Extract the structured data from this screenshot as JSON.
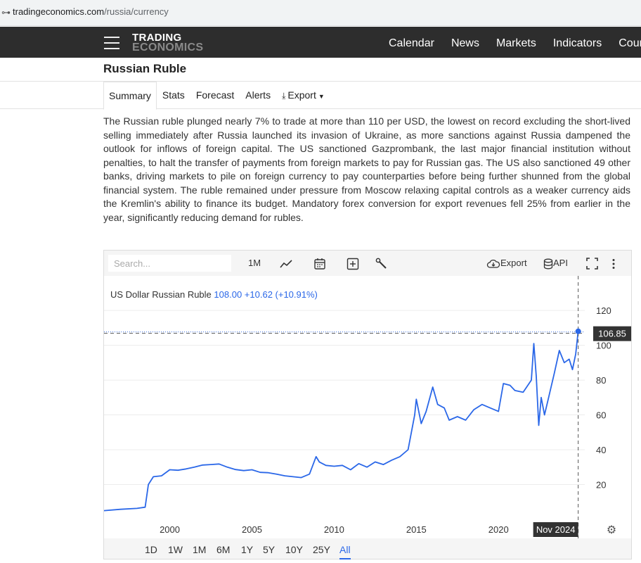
{
  "browser": {
    "url_host": "tradingeconomics.com",
    "url_path": "/russia/currency"
  },
  "nav": {
    "logo_line1": "TRADING",
    "logo_line2": "ECONOMICS",
    "links": [
      "Calendar",
      "News",
      "Markets",
      "Indicators",
      "Countries"
    ]
  },
  "page": {
    "title": "Russian Ruble"
  },
  "tabs": {
    "summary": "Summary",
    "stats": "Stats",
    "forecast": "Forecast",
    "alerts": "Alerts",
    "export": "Export"
  },
  "summary_text": "The Russian ruble plunged nearly 7% to trade at more than 110 per USD, the lowest on record excluding the short-lived selling immediately after Russia launched its invasion of Ukraine, as more sanctions against Russia dampened the outlook for inflows of foreign capital. The US sanctioned Gazprombank, the last major financial institution without penalties, to halt the transfer of payments from foreign markets to pay for Russian gas. The US also sanctioned 49 other banks, driving markets to pile on foreign currency to pay counterparties before being further shunned from the global financial system. The ruble remained under pressure from Moscow relaxing capital controls as a weaker currency aids the Kremlin's ability to finance its budget. Mandatory forex conversion for export revenues fell 25% from earlier in the year, significantly reducing demand for rubles.",
  "chart_toolbar": {
    "search_placeholder": "Search...",
    "interval_label": "1M",
    "line_icon": "line-chart-icon",
    "calendar_icon": "calendar-icon",
    "compare_icon": "plus-square-icon",
    "tools_icon": "wrench-icon",
    "export_label": "Export",
    "api_label": "API",
    "fullscreen_icon": "fullscreen-icon",
    "more_icon": "more-vertical-icon"
  },
  "chart_header": {
    "name": "US Dollar Russian Ruble",
    "value": "108.00",
    "change": "+10.62 (+10.91%)"
  },
  "crosshair": {
    "date_label": "Nov 2024",
    "price_label": "106.85",
    "price": 106.85
  },
  "range_buttons": [
    "1D",
    "1W",
    "1M",
    "6M",
    "1Y",
    "5Y",
    "10Y",
    "25Y",
    "All"
  ],
  "range_active": "All",
  "settings_icon": "gear-icon",
  "colors": {
    "series": "#2a67e8",
    "nav_bg": "#2d2d2d",
    "label_bg": "#333333"
  },
  "chart_data": {
    "type": "line",
    "title": "US Dollar Russian Ruble",
    "x_tick_labels": [
      "2000",
      "2005",
      "2010",
      "2015",
      "2020"
    ],
    "y_tick_labels": [
      "20",
      "40",
      "60",
      "80",
      "100",
      "120"
    ],
    "xlim": [
      1996.0,
      2025.25
    ],
    "ylim": [
      0,
      135
    ],
    "grid": "horizontal",
    "series": [
      {
        "x": [
          1996.0,
          1997.0,
          1998.0,
          1998.5,
          1998.7,
          1999.0,
          1999.5,
          2000.0,
          2000.5,
          2001.0,
          2001.5,
          2002.0,
          2002.5,
          2003.0,
          2003.5,
          2004.0,
          2004.5,
          2005.0,
          2005.5,
          2006.0,
          2006.5,
          2007.0,
          2007.5,
          2008.0,
          2008.5,
          2008.9,
          2009.1,
          2009.5,
          2010.0,
          2010.5,
          2011.0,
          2011.5,
          2012.0,
          2012.5,
          2013.0,
          2013.5,
          2014.0,
          2014.5,
          2014.9,
          2015.0,
          2015.3,
          2015.6,
          2016.0,
          2016.3,
          2016.7,
          2017.0,
          2017.5,
          2018.0,
          2018.5,
          2019.0,
          2019.5,
          2020.0,
          2020.3,
          2020.7,
          2021.0,
          2021.5,
          2022.0,
          2022.15,
          2022.3,
          2022.45,
          2022.6,
          2022.8,
          2023.0,
          2023.4,
          2023.7,
          2024.0,
          2024.3,
          2024.5,
          2024.7,
          2024.85
        ],
        "y": [
          5.0,
          5.8,
          6.3,
          7.0,
          20.0,
          24.5,
          25.0,
          28.5,
          28.2,
          29.0,
          30.0,
          31.2,
          31.5,
          31.8,
          30.0,
          28.6,
          28.0,
          28.5,
          27.0,
          26.8,
          26.0,
          25.0,
          24.5,
          24.0,
          26.0,
          36.0,
          33.0,
          31.0,
          30.5,
          31.0,
          28.5,
          32.0,
          30.0,
          33.0,
          31.5,
          34.0,
          36.0,
          40.0,
          60.0,
          69.0,
          55.0,
          62.0,
          76.0,
          66.0,
          64.0,
          57.0,
          59.0,
          57.0,
          63.0,
          66.0,
          64.0,
          62.0,
          78.0,
          77.0,
          74.0,
          73.0,
          80.0,
          101.0,
          82.0,
          54.0,
          70.0,
          60.0,
          68.0,
          84.0,
          97.0,
          90.0,
          92.0,
          86.0,
          95.0,
          108.0
        ]
      }
    ]
  }
}
